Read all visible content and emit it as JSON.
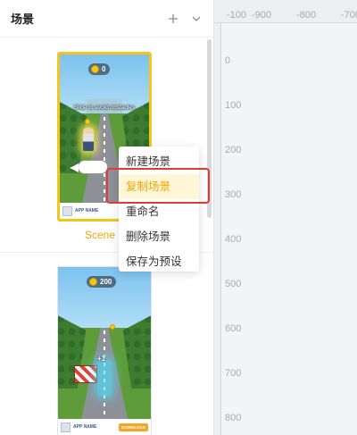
{
  "panel": {
    "title": "场景",
    "add_icon": "plus-icon",
    "collapse_icon": "chevron-down-icon"
  },
  "scenes": [
    {
      "name": "Scene",
      "selected": true,
      "preview": {
        "score": "0",
        "hint": "Slide to avoid obstacles",
        "app_name": "APP NAME"
      }
    },
    {
      "name": "",
      "selected": false,
      "preview": {
        "score": "200",
        "popup": "+1",
        "app_name": "APP NAME",
        "download_label": "DOWNLOAD"
      }
    }
  ],
  "context_menu": {
    "items": [
      {
        "label": "新建场景",
        "highlighted": false
      },
      {
        "label": "复制场景",
        "highlighted": true
      },
      {
        "label": "重命名",
        "highlighted": false
      },
      {
        "label": "删除场景",
        "highlighted": false
      },
      {
        "label": "保存为预设",
        "highlighted": false
      }
    ]
  },
  "ruler": {
    "top_labels": [
      "-100",
      "-900",
      "-800",
      "-700"
    ],
    "left_labels": [
      "0",
      "100",
      "200",
      "300",
      "400",
      "500",
      "600",
      "700",
      "800"
    ]
  },
  "colors": {
    "accent": "#f0a500",
    "selection_border": "#f5c518",
    "highlight_box": "#e53935"
  }
}
